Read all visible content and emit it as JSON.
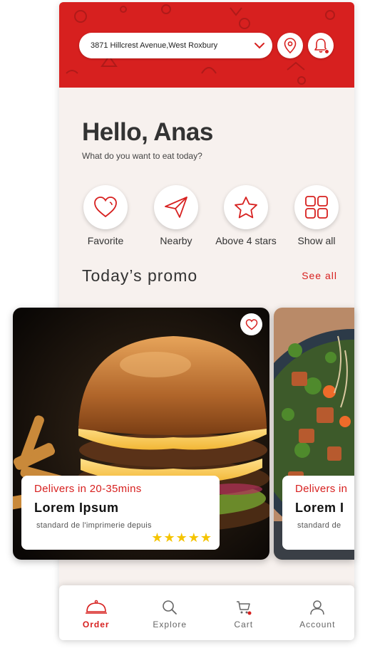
{
  "header": {
    "address": "3871  Hillcrest Avenue,West Roxbury",
    "brand_color": "#d7201f"
  },
  "greeting": {
    "title": "Hello, Anas",
    "subtitle": "What do you want to eat today?"
  },
  "categories": [
    {
      "label": "Favorite",
      "icon": "heart-icon"
    },
    {
      "label": "Nearby",
      "icon": "paper-plane-icon"
    },
    {
      "label": "Above 4 stars",
      "icon": "star-icon"
    },
    {
      "label": "Show all",
      "icon": "grid-icon"
    }
  ],
  "promo": {
    "title": "Today’s promo",
    "see_all": "See all",
    "cards": [
      {
        "delivery": "Delivers in 20-35mins",
        "name": "Lorem Ipsum",
        "description": "standard de l'imprimerie depuis",
        "rating": 5
      },
      {
        "delivery": "Delivers in",
        "name": "Lorem I",
        "description": "standard de"
      }
    ]
  },
  "nav": [
    {
      "label": "Order",
      "icon": "cloche-icon",
      "active": true
    },
    {
      "label": "Explore",
      "icon": "search-icon",
      "active": false
    },
    {
      "label": "Cart",
      "icon": "cart-icon",
      "active": false
    },
    {
      "label": "Account",
      "icon": "user-icon",
      "active": false
    }
  ]
}
